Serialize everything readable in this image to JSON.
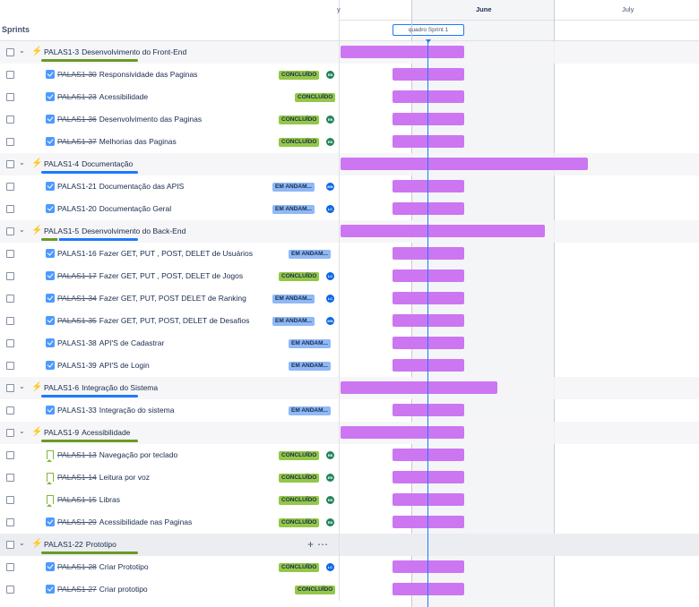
{
  "header": {
    "sprints_label": "Sprints",
    "months": [
      "y",
      "June",
      "July"
    ],
    "sprint_pill": "quadro Sprint 1"
  },
  "colors": {
    "epic_bar": "#cc76f1",
    "done_lozenge": "#94c748",
    "in_progress_lozenge": "#8fb8f6",
    "today_line": "#1d7afc"
  },
  "rows": [
    {
      "type": "epic",
      "key": "PALAS1-3",
      "title": "Desenvolvimento do Front-End",
      "done": false,
      "progress_done": 1.0,
      "progress_inprog": 0.0
    },
    {
      "type": "task",
      "key": "PALAS1-30",
      "title": "Responsividade das Paginas",
      "done": true,
      "status": "CONCLUÍDO",
      "status_kind": "done",
      "avatar": "EB",
      "avatar_color": "green"
    },
    {
      "type": "task",
      "key": "PALAS1-23",
      "title": "Acessibilidade",
      "done": true,
      "status": "CONCLUÍDO",
      "status_kind": "done",
      "avatar": "",
      "avatar_color": ""
    },
    {
      "type": "task",
      "key": "PALAS1-36",
      "title": "Desenvolvimento das Paginas",
      "done": true,
      "status": "CONCLUÍDO",
      "status_kind": "done",
      "avatar": "EB",
      "avatar_color": "green"
    },
    {
      "type": "task",
      "key": "PALAS1-37",
      "title": "Melhorias das Paginas",
      "done": true,
      "status": "CONCLUÍDO",
      "status_kind": "done",
      "avatar": "EB",
      "avatar_color": "green"
    },
    {
      "type": "epic",
      "key": "PALAS1-4",
      "title": "Documentação",
      "done": false,
      "progress_done": 0.0,
      "progress_inprog": 1.0
    },
    {
      "type": "task",
      "key": "PALAS1-21",
      "title": "Documentação das APIS",
      "done": false,
      "status": "EM ANDAM...",
      "status_kind": "prog",
      "avatar": "MN",
      "avatar_color": "blue"
    },
    {
      "type": "task",
      "key": "PALAS1-20",
      "title": "Documentação Geral",
      "done": false,
      "status": "EM ANDAM...",
      "status_kind": "prog",
      "avatar": "LC",
      "avatar_color": "blue"
    },
    {
      "type": "epic",
      "key": "PALAS1-5",
      "title": "Desenvolvimento do Back-End",
      "done": false,
      "progress_done": 0.17,
      "progress_inprog": 0.83
    },
    {
      "type": "task",
      "key": "PALAS1-16",
      "title": "Fazer GET, PUT , POST, DELET de Usuários",
      "done": false,
      "status": "EM ANDAM...",
      "status_kind": "prog",
      "avatar": "",
      "avatar_color": ""
    },
    {
      "type": "task",
      "key": "PALAS1-17",
      "title": "Fazer GET, PUT , POST, DELET de Jogos",
      "done": true,
      "status": "CONCLUÍDO",
      "status_kind": "done",
      "avatar": "LC",
      "avatar_color": "blue"
    },
    {
      "type": "task",
      "key": "PALAS1-34",
      "title": "Fazer GET, PUT, POST DELET de Ranking",
      "done": true,
      "status": "EM ANDAM...",
      "status_kind": "prog",
      "avatar": "LC",
      "avatar_color": "blue"
    },
    {
      "type": "task",
      "key": "PALAS1-35",
      "title": "Fazer GET, PUT, POST, DELET de Desafios",
      "done": true,
      "status": "EM ANDAM...",
      "status_kind": "prog",
      "avatar": "MN",
      "avatar_color": "blue"
    },
    {
      "type": "task",
      "key": "PALAS1-38",
      "title": "API'S de Cadastrar",
      "done": false,
      "status": "EM ANDAM...",
      "status_kind": "prog",
      "avatar": "",
      "avatar_color": ""
    },
    {
      "type": "task",
      "key": "PALAS1-39",
      "title": "API'S de Login",
      "done": false,
      "status": "EM ANDAM...",
      "status_kind": "prog",
      "avatar": "",
      "avatar_color": ""
    },
    {
      "type": "epic",
      "key": "PALAS1-6",
      "title": "Integração do Sistema",
      "done": false,
      "progress_done": 0.0,
      "progress_inprog": 1.0
    },
    {
      "type": "task",
      "key": "PALAS1-33",
      "title": "Integração do sistema",
      "done": false,
      "status": "EM ANDAM...",
      "status_kind": "prog",
      "avatar": "",
      "avatar_color": ""
    },
    {
      "type": "epic",
      "key": "PALAS1-9",
      "title": "Acessibilidade",
      "done": false,
      "progress_done": 1.0,
      "progress_inprog": 0.0
    },
    {
      "type": "story",
      "key": "PALAS1-13",
      "title": "Navegação por teclado",
      "done": true,
      "status": "CONCLUÍDO",
      "status_kind": "done",
      "avatar": "EB",
      "avatar_color": "green"
    },
    {
      "type": "story",
      "key": "PALAS1-14",
      "title": "Leitura por voz",
      "done": true,
      "status": "CONCLUÍDO",
      "status_kind": "done",
      "avatar": "EB",
      "avatar_color": "green"
    },
    {
      "type": "story",
      "key": "PALAS1-15",
      "title": "Libras",
      "done": true,
      "status": "CONCLUÍDO",
      "status_kind": "done",
      "avatar": "EB",
      "avatar_color": "green"
    },
    {
      "type": "task",
      "key": "PALAS1-29",
      "title": "Acessibilidade nas Paginas",
      "done": true,
      "status": "CONCLUÍDO",
      "status_kind": "done",
      "avatar": "EB",
      "avatar_color": "green"
    },
    {
      "type": "epic",
      "key": "PALAS1-22",
      "title": "Prototipo",
      "done": false,
      "progress_done": 1.0,
      "progress_inprog": 0.0,
      "selected": true
    },
    {
      "type": "task",
      "key": "PALAS1-28",
      "title": "Criar Prototipo",
      "done": true,
      "status": "CONCLUÍDO",
      "status_kind": "done",
      "avatar": "LC",
      "avatar_color": "blue"
    },
    {
      "type": "task",
      "key": "PALAS1-27",
      "title": "Criar prototipo",
      "done": true,
      "status": "CONCLUÍDO",
      "status_kind": "done",
      "avatar": "",
      "avatar_color": ""
    }
  ]
}
